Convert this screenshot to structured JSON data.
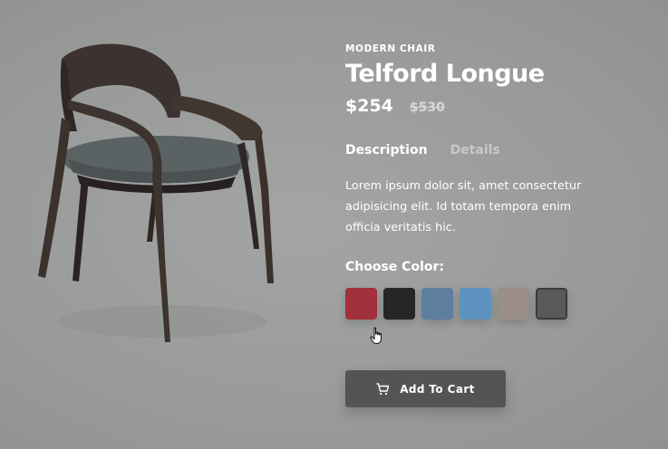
{
  "product": {
    "category": "MODERN CHAIR",
    "name": "Telford Longue",
    "price": "$254",
    "old_price": "$530"
  },
  "tabs": [
    {
      "label": "Description",
      "active": true
    },
    {
      "label": "Details",
      "active": false
    }
  ],
  "description": "Lorem ipsum dolor sit, amet consectetur adipisicing elit. Id totam tempora enim officia veritatis hic.",
  "color_picker": {
    "label": "Choose Color:",
    "swatches": [
      {
        "name": "red",
        "color": "#a3303d",
        "selected": false
      },
      {
        "name": "black",
        "color": "#252626",
        "selected": false
      },
      {
        "name": "denim-blue",
        "color": "#5f7f9f",
        "selected": false
      },
      {
        "name": "light-blue",
        "color": "#5e93c0",
        "selected": false
      },
      {
        "name": "tan",
        "color": "#9a8e86",
        "selected": false
      },
      {
        "name": "gray",
        "color": "#585a59",
        "selected": true
      }
    ]
  },
  "cart_button": {
    "label": "Add To Cart",
    "icon": "cart-icon"
  },
  "image": {
    "icon": "chair-image"
  }
}
